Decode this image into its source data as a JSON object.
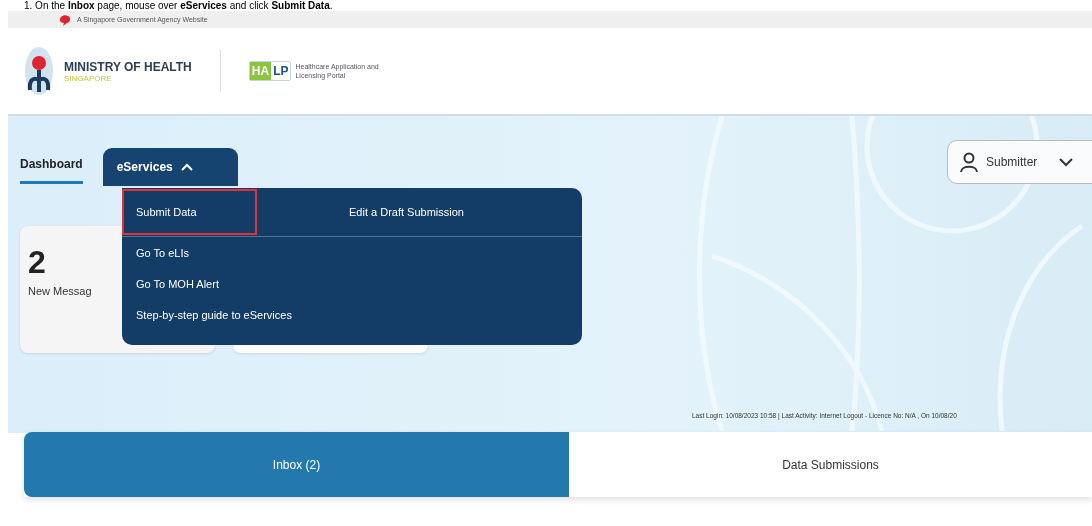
{
  "instruction": "1.  On the **Inbox** page, mouse over **eServices** and click **Submit Data**.",
  "gov_bar": {
    "text": "A Singapore Government Agency Website"
  },
  "header": {
    "ministry": "MINISTRY OF HEALTH",
    "country": "SINGAPORE",
    "portal_badge": [
      "HA",
      "LP"
    ],
    "portal_name": "Healthcare Application and Licensing Portal"
  },
  "nav": [
    {
      "label": "Dashboard",
      "selected": true,
      "kind": "link"
    },
    {
      "label": "eServices",
      "kind": "dropdown",
      "expanded": true
    }
  ],
  "user_menu": {
    "label": "Submitter"
  },
  "dropdown": {
    "items": [
      {
        "label": "Submit Data",
        "highlighted": true,
        "kind": "first"
      },
      {
        "label": "Edit a Draft Submission",
        "highlighted": false,
        "kind": "first"
      },
      {
        "label": "Go To eLIs",
        "highlighted": false,
        "kind": "row"
      },
      {
        "label": "Go To MOH Alert",
        "highlighted": false,
        "kind": "row"
      },
      {
        "label": "Step-by-step guide to eServices",
        "highlighted": false,
        "kind": "row"
      }
    ]
  },
  "cards": [
    {
      "kind": "count",
      "count": "2",
      "label": "New Messag"
    },
    {
      "kind": "blank"
    }
  ],
  "last_login": "Last Login: 10/08/2023 10:58 | Last Activity: Internet Logout - Licence No: N/A , On 10/08/20",
  "tabs": [
    {
      "label": "Inbox (2)",
      "selected": true
    },
    {
      "label": "Data Submissions",
      "selected": false
    }
  ]
}
